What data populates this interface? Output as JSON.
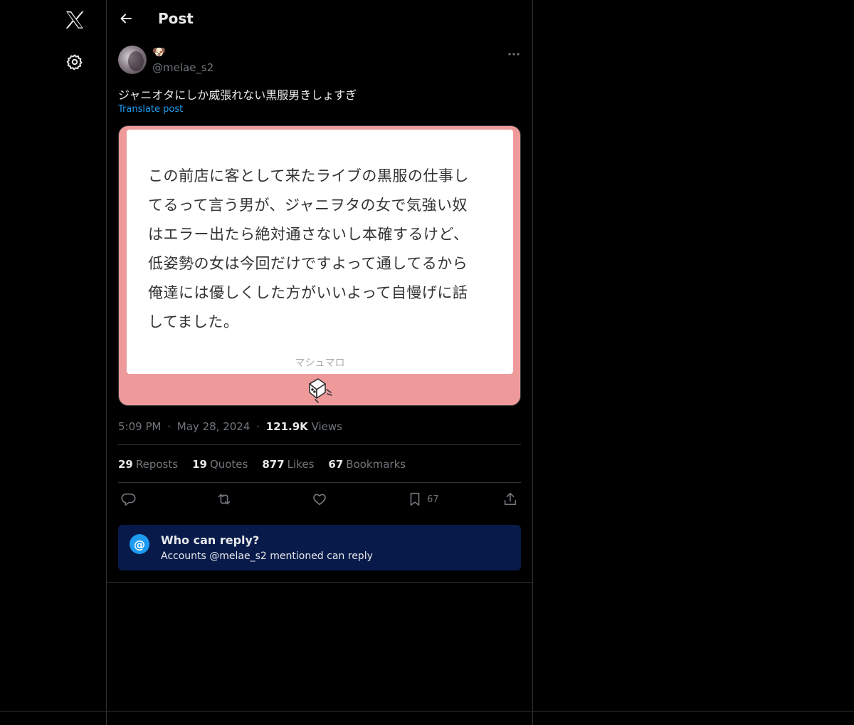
{
  "app": {
    "logo": "X"
  },
  "sidebar": {
    "items": [
      {
        "icon": "x-logo-icon"
      },
      {
        "icon": "gear-icon"
      }
    ]
  },
  "header": {
    "title": "Post"
  },
  "post": {
    "display_name": "🐶",
    "handle": "@melae_s2",
    "text": "ジャニオタにしか威張れない黒服男きしょすぎ",
    "translate_label": "Translate post",
    "media": {
      "lines": [
        "この前店に客として来たライブの黒服の仕事し",
        "てるって言う男が、ジャニヲタの女で気強い奴",
        "はエラー出たら絶対通さないし本確するけど、",
        "低姿勢の女は今回だけですよって通してるから",
        "俺達には優しくした方がいいよって自慢げに話",
        "してました。"
      ],
      "footer": "マシュマロ",
      "background_color": "#ee9a9b"
    },
    "time": "5:09 PM",
    "sep": "·",
    "date": "May 28, 2024",
    "views_count": "121.9K",
    "views_label": "Views"
  },
  "stats": {
    "reposts": {
      "count": "29",
      "label": "Reposts"
    },
    "quotes": {
      "count": "19",
      "label": "Quotes"
    },
    "likes": {
      "count": "877",
      "label": "Likes"
    },
    "bookmarks": {
      "count": "67",
      "label": "Bookmarks"
    }
  },
  "actions": {
    "reply": {
      "icon": "reply-icon"
    },
    "repost": {
      "icon": "repost-icon"
    },
    "like": {
      "icon": "heart-icon"
    },
    "bookmark": {
      "icon": "bookmark-icon",
      "count": "67"
    },
    "share": {
      "icon": "share-icon"
    }
  },
  "who_can_reply": {
    "icon": "@",
    "title": "Who can reply?",
    "subtitle": "Accounts @melae_s2 mentioned can reply",
    "background_color": "#071a4a",
    "accent_color": "#1d9bf0"
  }
}
